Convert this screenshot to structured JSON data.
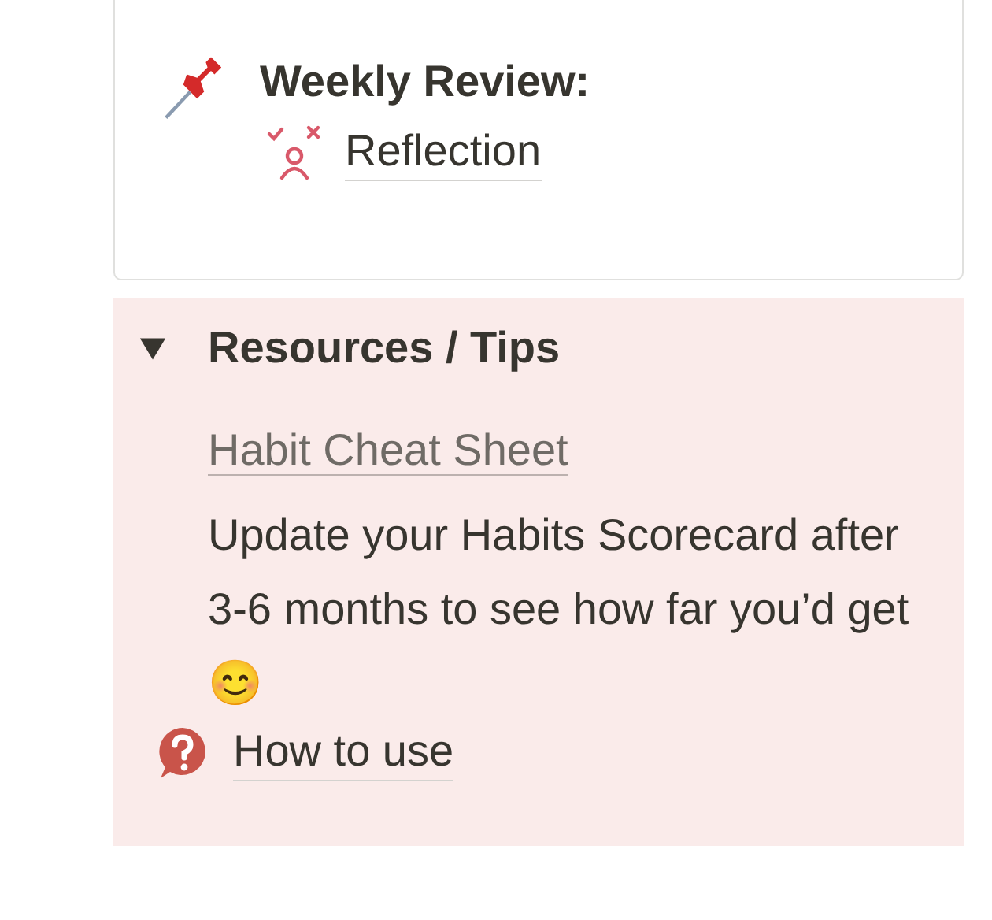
{
  "callout": {
    "title": "Weekly Review:",
    "link": "Reflection"
  },
  "toggle": {
    "title": "Resources / Tips",
    "expanded": true,
    "link": "Habit Cheat Sheet",
    "text": "Update your Habits Scorecard after 3-6 months to see how far you’d get 😊",
    "help_link": "How to use"
  }
}
